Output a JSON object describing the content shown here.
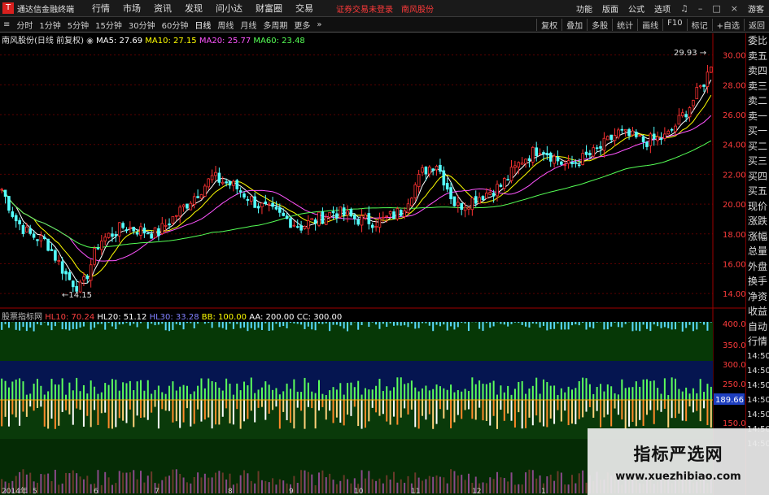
{
  "app": {
    "name": "通达信金融终端",
    "logo_glyph": "T"
  },
  "menus": [
    "行情",
    "市场",
    "资讯",
    "发现",
    "问小达",
    "财富圈",
    "交易"
  ],
  "status": {
    "login": "证券交易未登录",
    "stock": "南风股份"
  },
  "menu_right": [
    "功能",
    "版面",
    "公式",
    "选项"
  ],
  "guest": "游客",
  "periods": [
    "分时",
    "1分钟",
    "5分钟",
    "15分钟",
    "30分钟",
    "60分钟",
    "日线",
    "周线",
    "月线",
    "多周期",
    "更多"
  ],
  "active_period": "日线",
  "toolbar_right": [
    "复权",
    "叠加",
    "多股",
    "统计",
    "画线",
    "F10",
    "标记",
    "+自选",
    "返回"
  ],
  "chart_title": "南风股份(日线 前复权)",
  "ma": [
    {
      "label": "MA5: 27.69",
      "color": "#ffffff"
    },
    {
      "label": "MA10: 27.15",
      "color": "#ffff00"
    },
    {
      "label": "MA20: 25.77",
      "color": "#ff55ff"
    },
    {
      "label": "MA60: 23.48",
      "color": "#55ff55"
    }
  ],
  "price_axis": [
    "30.00",
    "28.00",
    "26.00",
    "24.00",
    "22.00",
    "20.00",
    "18.00",
    "16.00",
    "14.00"
  ],
  "annotations": {
    "high": "29.93",
    "low": "14.15"
  },
  "indicator_name": "股票指标网",
  "indicator_values": [
    {
      "label": "HL10: 70.24",
      "color": "#ff4040"
    },
    {
      "label": "HL20: 51.12",
      "color": "#ffffff"
    },
    {
      "label": "HL30: 33.28",
      "color": "#8080ff"
    },
    {
      "label": "BB: 100.00",
      "color": "#ffff00"
    },
    {
      "label": "AA: 200.00",
      "color": "#ffffff"
    },
    {
      "label": "CC: 300.00",
      "color": "#ffffff"
    }
  ],
  "ind_axis": [
    "400.0",
    "350.0",
    "300.0",
    "250.0",
    "150.0"
  ],
  "ind_current": "189.66",
  "months": [
    "2014年",
    "5",
    "6",
    "7",
    "8",
    "9",
    "10",
    "11",
    "12",
    "1"
  ],
  "right_panel": [
    "委比",
    "卖五",
    "卖四",
    "卖三",
    "卖二",
    "卖一",
    "买一",
    "买二",
    "买三",
    "买四",
    "买五",
    "现价",
    "涨跌",
    "涨幅",
    "总量",
    "外盘",
    "换手",
    "净资",
    "收益",
    "自动",
    "行情"
  ],
  "right_times": [
    "14:50",
    "14:50",
    "14:50",
    "14:50",
    "14:50",
    "14:50",
    "14:50"
  ],
  "watermark": {
    "title": "指标严选网",
    "url": "www.xuezhibiao.com"
  },
  "colors": {
    "up": "#ff3232",
    "down": "#54ffff",
    "grid": "#7a0000"
  }
}
